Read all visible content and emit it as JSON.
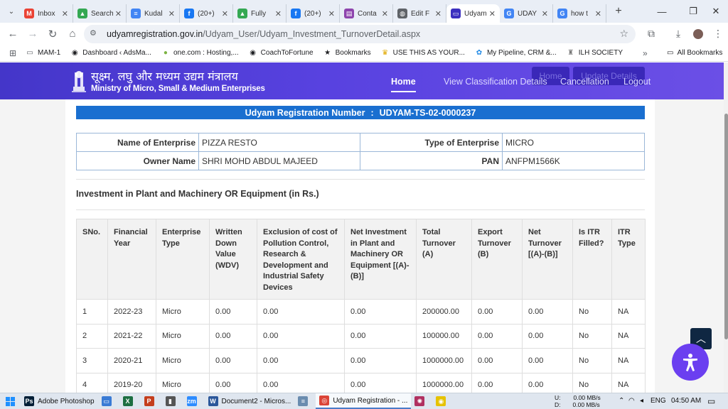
{
  "browser": {
    "tabs": [
      {
        "title": "Inbox",
        "icon": "gmail-icon",
        "color": "#ea4335",
        "glyph": "M",
        "active": false
      },
      {
        "title": "Search",
        "icon": "drive-icon",
        "color": "#34a853",
        "glyph": "▲",
        "active": false
      },
      {
        "title": "Kudal",
        "icon": "docs-icon",
        "color": "#4285f4",
        "glyph": "≡",
        "active": false
      },
      {
        "title": "(20+)",
        "icon": "facebook-icon",
        "color": "#1877f2",
        "glyph": "f",
        "active": false
      },
      {
        "title": "Fully",
        "icon": "drive-icon",
        "color": "#34a853",
        "glyph": "▲",
        "active": false
      },
      {
        "title": "(20+)",
        "icon": "facebook-icon",
        "color": "#1877f2",
        "glyph": "f",
        "active": false
      },
      {
        "title": "Conta",
        "icon": "site-icon",
        "color": "#8e44ad",
        "glyph": "▤",
        "active": false
      },
      {
        "title": "Edit F",
        "icon": "globe-icon",
        "color": "#5f6368",
        "glyph": "◍",
        "active": false
      },
      {
        "title": "Udyam",
        "icon": "udyam-icon",
        "color": "#3b2fbf",
        "glyph": "▭",
        "active": true
      },
      {
        "title": "UDAY",
        "icon": "google-icon",
        "color": "#4285f4",
        "glyph": "G",
        "active": false
      },
      {
        "title": "how t",
        "icon": "google-icon",
        "color": "#4285f4",
        "glyph": "G",
        "active": false
      }
    ],
    "url_host": "udyamregistration.gov.in",
    "url_path": "/Udyam_User/Udyam_Investment_TurnoverDetail.aspx",
    "bookmarks": [
      {
        "label": "MAM-1",
        "icon": "folder-icon",
        "glyph": "▭",
        "color": "#5f6368"
      },
      {
        "label": "Dashboard ‹ AdsMa...",
        "icon": "site-icon",
        "glyph": "◉",
        "color": "#202124"
      },
      {
        "label": "one.com : Hosting,...",
        "icon": "onecom-icon",
        "glyph": "●",
        "color": "#7cb342"
      },
      {
        "label": "CoachToFortune",
        "icon": "site-icon",
        "glyph": "◉",
        "color": "#202124"
      },
      {
        "label": "Bookmarks",
        "icon": "star-icon",
        "glyph": "★",
        "color": "#202124"
      },
      {
        "label": "USE THIS AS YOUR...",
        "icon": "site-icon",
        "glyph": "♛",
        "color": "#e0a800"
      },
      {
        "label": "My Pipeline, CRM &...",
        "icon": "site-icon",
        "glyph": "✿",
        "color": "#1e88e5"
      },
      {
        "label": "ILH SOCIETY",
        "icon": "site-icon",
        "glyph": "♜",
        "color": "#777777"
      }
    ],
    "all_bookmarks": "All Bookmarks"
  },
  "site": {
    "hindi_title": "सूक्ष्म, लघु और मध्यम उद्यम मंत्रालय",
    "eng_title": "Ministry of Micro, Small & Medium Enterprises",
    "ghost_buttons": [
      "Home",
      "Update Details"
    ],
    "nav": [
      "Home",
      "View Classification Details",
      "Cancellation",
      "Logout"
    ]
  },
  "registration": {
    "label": "Udyam Registration Number",
    "separator": ":",
    "number": "UDYAM-TS-02-0000237"
  },
  "enterprise": {
    "name_label": "Name of Enterprise",
    "name": "PIZZA RESTO",
    "type_label": "Type of Enterprise",
    "type": "MICRO",
    "owner_label": "Owner Name",
    "owner": "SHRI MOHD ABDUL MAJEED",
    "pan_label": "PAN",
    "pan": "ANFPM1566K"
  },
  "investment": {
    "heading": "Investment in Plant and Machinery OR Equipment (in Rs.)",
    "columns": [
      "SNo.",
      "Financial Year",
      "Enterprise Type",
      "Written Down Value (WDV)",
      "Exclusion of cost of Pollution Control, Research & Development and Industrial Safety Devices",
      "Net Investment in Plant and Machinery OR Equipment [(A)-(B)]",
      "Total Turnover (A)",
      "Export Turnover (B)",
      "Net Turnover [(A)-(B)]",
      "Is ITR Filled?",
      "ITR Type"
    ],
    "rows": [
      [
        "1",
        "2022-23",
        "Micro",
        "0.00",
        "0.00",
        "0.00",
        "200000.00",
        "0.00",
        "0.00",
        "No",
        "NA"
      ],
      [
        "2",
        "2021-22",
        "Micro",
        "0.00",
        "0.00",
        "0.00",
        "100000.00",
        "0.00",
        "0.00",
        "No",
        "NA"
      ],
      [
        "3",
        "2020-21",
        "Micro",
        "0.00",
        "0.00",
        "0.00",
        "1000000.00",
        "0.00",
        "0.00",
        "No",
        "NA"
      ],
      [
        "4",
        "2019-20",
        "Micro",
        "0.00",
        "0.00",
        "0.00",
        "1000000.00",
        "0.00",
        "0.00",
        "No",
        "NA"
      ]
    ]
  },
  "taskbar": {
    "items": [
      {
        "label": "Adobe Photoshop",
        "icon": "photoshop-icon",
        "color": "#001e36",
        "glyph": "Ps",
        "active": false
      },
      {
        "label": "",
        "icon": "monitor-icon",
        "color": "#3a7bd5",
        "glyph": "▭",
        "active": false
      },
      {
        "label": "",
        "icon": "excel-icon",
        "color": "#1d6f42",
        "glyph": "X",
        "active": false
      },
      {
        "label": "",
        "icon": "powerpoint-icon",
        "color": "#c43e1c",
        "glyph": "P",
        "active": false
      },
      {
        "label": "",
        "icon": "usb-icon",
        "color": "#555555",
        "glyph": "▮",
        "active": false
      },
      {
        "label": "",
        "icon": "zoom-icon",
        "color": "#2d8cff",
        "glyph": "zm",
        "active": false
      },
      {
        "label": "Document2 - Micros...",
        "icon": "word-icon",
        "color": "#2b579a",
        "glyph": "W",
        "active": false
      },
      {
        "label": "",
        "icon": "notepad-icon",
        "color": "#6a8caf",
        "glyph": "≡",
        "active": false
      },
      {
        "label": "Udyam Registration - ...",
        "icon": "chrome-icon",
        "color": "#db4437",
        "glyph": "◎",
        "active": true
      },
      {
        "label": "",
        "icon": "app-icon",
        "color": "#b03060",
        "glyph": "✺",
        "active": false
      },
      {
        "label": "",
        "icon": "snapchat-icon",
        "color": "#e6c200",
        "glyph": "◉",
        "active": false
      }
    ],
    "net_up_label": "U:",
    "net_up": "0.00 MB/s",
    "net_down_label": "D:",
    "net_down": "0.00 MB/s",
    "language": "ENG",
    "time": "04:50 AM"
  }
}
